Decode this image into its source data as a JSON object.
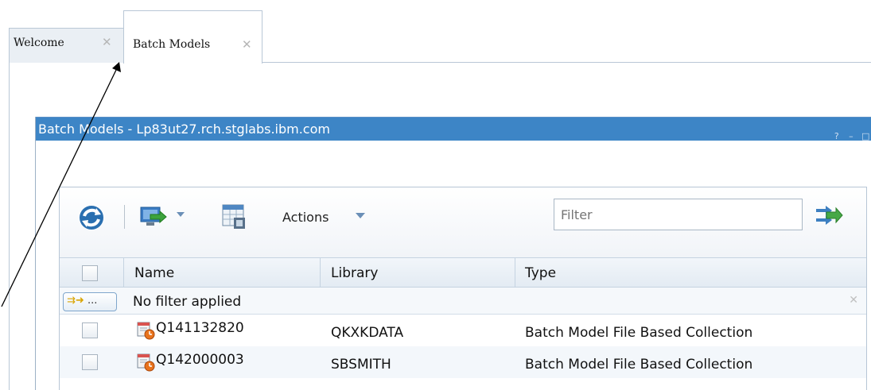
{
  "tabs": [
    {
      "label": "Welcome",
      "active": false
    },
    {
      "label": "Batch Models",
      "active": true
    }
  ],
  "portlet": {
    "title": "Batch Models - Lp83ut27.rch.stglabs.ibm.com",
    "controls": [
      "?",
      "–",
      "□"
    ],
    "title_bg": "#3d85c6"
  },
  "toolbar": {
    "refresh_icon": "refresh-icon",
    "actions_label": "Actions",
    "filter_placeholder": "Filter",
    "filter_icon": "filter-go-icon"
  },
  "table": {
    "columns": [
      "Name",
      "Library",
      "Type"
    ],
    "filter_button": "...",
    "filter_status": "No filter applied",
    "rows": [
      {
        "name": "Q141132820",
        "library": "QKXKDATA",
        "type": "Batch Model File Based Collection"
      },
      {
        "name": "Q142000003",
        "library": "SBSMITH",
        "type": "Batch Model File Based Collection"
      }
    ]
  }
}
